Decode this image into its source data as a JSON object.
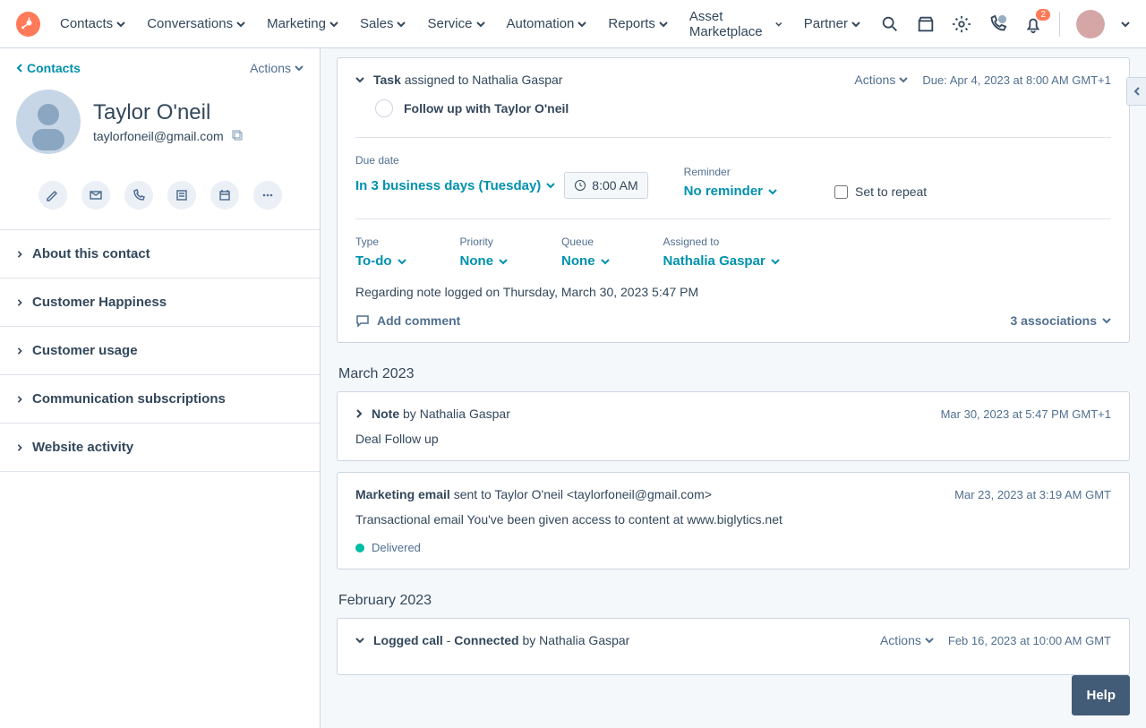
{
  "topnav": {
    "items": [
      "Contacts",
      "Conversations",
      "Marketing",
      "Sales",
      "Service",
      "Automation",
      "Reports",
      "Asset Marketplace",
      "Partner"
    ],
    "notification_count": "2"
  },
  "left": {
    "back_label": "Contacts",
    "actions_label": "Actions",
    "contact_name": "Taylor O'neil",
    "contact_email": "taylorfoneil@gmail.com",
    "accordion": [
      "About this contact",
      "Customer Happiness",
      "Customer usage",
      "Communication subscriptions",
      "Website activity"
    ]
  },
  "task": {
    "prefix": "Task",
    "assigned_text": "assigned to",
    "assigned_to": "Nathalia Gaspar",
    "actions_label": "Actions",
    "due_label": "Due:",
    "due_value": "Apr 4, 2023 at 8:00 AM GMT+1",
    "title": "Follow up with Taylor O'neil",
    "fields": {
      "due_date_label": "Due date",
      "due_date_value": "In 3 business days (Tuesday)",
      "time_value": "8:00 AM",
      "reminder_label": "Reminder",
      "reminder_value": "No reminder",
      "repeat_label": "Set to repeat",
      "type_label": "Type",
      "type_value": "To-do",
      "priority_label": "Priority",
      "priority_value": "None",
      "queue_label": "Queue",
      "queue_value": "None",
      "assigned_to_label": "Assigned to",
      "assigned_to_value": "Nathalia Gaspar"
    },
    "note": "Regarding note logged on Thursday, March 30, 2023 5:47 PM",
    "add_comment": "Add comment",
    "associations": "3 associations"
  },
  "months": {
    "march": "March 2023",
    "february": "February 2023"
  },
  "note_card": {
    "prefix": "Note",
    "by": "by",
    "author": "Nathalia Gaspar",
    "date": "Mar 30, 2023 at 5:47 PM GMT+1",
    "body": "Deal Follow up"
  },
  "email_card": {
    "prefix": "Marketing email",
    "sent_text": "sent to",
    "to_name": "Taylor O'neil",
    "to_addr": "<taylorfoneil@gmail.com>",
    "date": "Mar 23, 2023 at 3:19 AM GMT",
    "body": "Transactional email You've been given access to content at www.biglytics.net",
    "status": "Delivered"
  },
  "call_card": {
    "prefix": "Logged call",
    "dash": "-",
    "status": "Connected",
    "by": "by",
    "author": "Nathalia Gaspar",
    "actions_label": "Actions",
    "date": "Feb 16, 2023 at 10:00 AM GMT"
  },
  "help_label": "Help"
}
